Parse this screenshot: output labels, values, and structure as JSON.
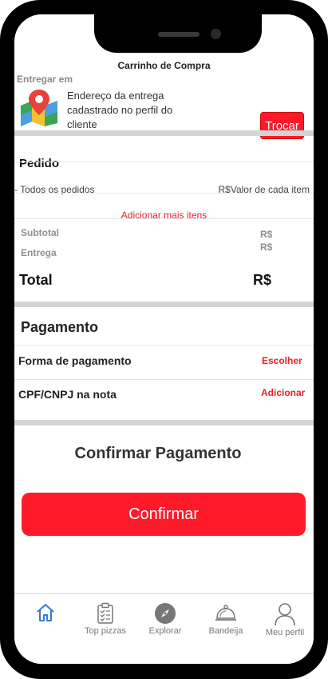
{
  "header": {
    "title": "Carrinho de Compra"
  },
  "delivery": {
    "label": "Entregar em",
    "address": "Endereço da entrega cadastrado no perfil do cliente",
    "change_button": "Trocar"
  },
  "order": {
    "title": "Pedido",
    "items_label": "- Todos os pedidos",
    "items_value": "R$Valor de cada item",
    "add_more": "Adicionar mais itens",
    "subtotal_label": "Subtotal",
    "subtotal_value": "R$",
    "delivery_label": "Entrega",
    "delivery_value": "R$",
    "total_label": "Total",
    "total_value": "R$"
  },
  "payment": {
    "title": "Pagamento",
    "method_label": "Forma de pagamento",
    "method_action": "Escolher",
    "tax_id_label": "CPF/CNPJ na nota",
    "tax_id_action": "Adicionar"
  },
  "confirm": {
    "title": "Confirmar Pagamento",
    "button": "Confirmar"
  },
  "tabbar": {
    "items": [
      {
        "label": "",
        "icon": "home-icon",
        "active": true
      },
      {
        "label": "Top pizzas",
        "icon": "clipboard-list-icon"
      },
      {
        "label": "Explorar",
        "icon": "compass-icon"
      },
      {
        "label": "Bandeija",
        "icon": "cloche-icon"
      },
      {
        "label": "Meu perfil",
        "icon": "user-icon"
      }
    ]
  },
  "colors": {
    "accent": "#ff1a2a",
    "accent_text": "#e8202a",
    "home_active": "#2f7fd6"
  }
}
